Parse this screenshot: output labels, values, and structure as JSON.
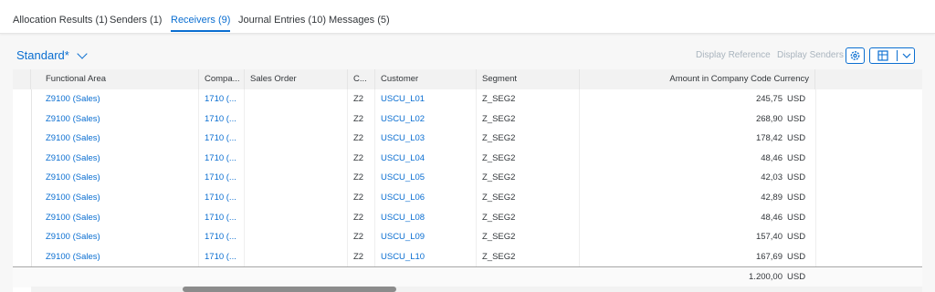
{
  "tabs": [
    {
      "label": "Allocation Results (1)",
      "active": false
    },
    {
      "label": "Senders (1)",
      "active": false
    },
    {
      "label": "Receivers (9)",
      "active": true
    },
    {
      "label": "Journal Entries (10)",
      "active": false
    },
    {
      "label": "Messages (5)",
      "active": false
    }
  ],
  "toolbar": {
    "variant": "Standard*",
    "display_reference": "Display Reference",
    "display_senders": "Display Senders"
  },
  "columns": [
    "Functional Area",
    "Compa...",
    "Sales Order",
    "C...",
    "Customer",
    "Segment",
    "Amount in Company Code Currency"
  ],
  "rows": [
    {
      "functional_area": "Z9100 (Sales)",
      "company": "1710 (...",
      "sales_order": "",
      "c": "Z2",
      "customer": "USCU_L01",
      "segment": "Z_SEG2",
      "amount": "245,75",
      "currency": "USD"
    },
    {
      "functional_area": "Z9100 (Sales)",
      "company": "1710 (...",
      "sales_order": "",
      "c": "Z2",
      "customer": "USCU_L02",
      "segment": "Z_SEG2",
      "amount": "268,90",
      "currency": "USD"
    },
    {
      "functional_area": "Z9100 (Sales)",
      "company": "1710 (...",
      "sales_order": "",
      "c": "Z2",
      "customer": "USCU_L03",
      "segment": "Z_SEG2",
      "amount": "178,42",
      "currency": "USD"
    },
    {
      "functional_area": "Z9100 (Sales)",
      "company": "1710 (...",
      "sales_order": "",
      "c": "Z2",
      "customer": "USCU_L04",
      "segment": "Z_SEG2",
      "amount": "48,46",
      "currency": "USD"
    },
    {
      "functional_area": "Z9100 (Sales)",
      "company": "1710 (...",
      "sales_order": "",
      "c": "Z2",
      "customer": "USCU_L05",
      "segment": "Z_SEG2",
      "amount": "42,03",
      "currency": "USD"
    },
    {
      "functional_area": "Z9100 (Sales)",
      "company": "1710 (...",
      "sales_order": "",
      "c": "Z2",
      "customer": "USCU_L06",
      "segment": "Z_SEG2",
      "amount": "42,89",
      "currency": "USD"
    },
    {
      "functional_area": "Z9100 (Sales)",
      "company": "1710 (...",
      "sales_order": "",
      "c": "Z2",
      "customer": "USCU_L08",
      "segment": "Z_SEG2",
      "amount": "48,46",
      "currency": "USD"
    },
    {
      "functional_area": "Z9100 (Sales)",
      "company": "1710 (...",
      "sales_order": "",
      "c": "Z2",
      "customer": "USCU_L09",
      "segment": "Z_SEG2",
      "amount": "157,40",
      "currency": "USD"
    },
    {
      "functional_area": "Z9100 (Sales)",
      "company": "1710 (...",
      "sales_order": "",
      "c": "Z2",
      "customer": "USCU_L10",
      "segment": "Z_SEG2",
      "amount": "167,69",
      "currency": "USD"
    }
  ],
  "total": {
    "amount": "1.200,00",
    "currency": "USD"
  },
  "icons": {
    "settings": "gear-icon",
    "export": "spreadsheet-export-icon",
    "menu": "chevron-down-icon"
  },
  "colors": {
    "accent": "#0a6ed1",
    "disabled": "#a9b4be"
  }
}
